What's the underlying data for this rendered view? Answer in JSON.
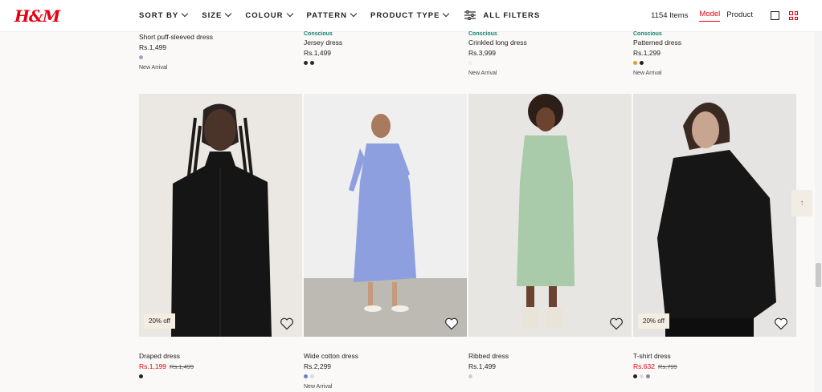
{
  "header": {
    "logo": "H&M",
    "filters": [
      "SORT BY",
      "SIZE",
      "COLOUR",
      "PATTERN",
      "PRODUCT TYPE"
    ],
    "all_filters": "ALL FILTERS",
    "item_count": "1154 Items",
    "view_model": "Model",
    "view_product": "Product"
  },
  "top_row": [
    {
      "tag": "",
      "name": "Short puff-sleeved dress",
      "price": "Rs.1,499",
      "swatches": [
        "#9aa6cf"
      ],
      "marker": "New Arrival"
    },
    {
      "tag": "Conscious",
      "name": "Jersey dress",
      "price": "Rs.1,499",
      "swatches": [
        "#2a2a2a",
        "#2a2a2a"
      ],
      "marker": ""
    },
    {
      "tag": "Conscious",
      "name": "Crinkled long dress",
      "price": "Rs.3,999",
      "swatches": [
        "#eeeeee"
      ],
      "marker": "New Arrival"
    },
    {
      "tag": "Conscious",
      "name": "Patterned dress",
      "price": "Rs.1,299",
      "swatches": [
        "#e89a3a",
        "#222222"
      ],
      "marker": "New Arrival"
    }
  ],
  "bottom_row": [
    {
      "name": "Draped dress",
      "price": "Rs.1,199",
      "old_price": "Rs.1,499",
      "badge": "20% off",
      "swatches": [
        "#222222"
      ],
      "marker": ""
    },
    {
      "name": "Wide cotton dress",
      "price": "Rs.2,299",
      "old_price": "",
      "badge": "",
      "swatches": [
        "#6a7fc8",
        "#dddddd"
      ],
      "marker": "New Arrival"
    },
    {
      "name": "Ribbed dress",
      "price": "Rs.1,499",
      "old_price": "",
      "badge": "",
      "swatches": [
        "#cccccc"
      ],
      "marker": ""
    },
    {
      "name": "T-shirt dress",
      "price": "Rs.632",
      "old_price": "Rs.799",
      "badge": "20% off",
      "swatches": [
        "#222222",
        "#dddddd",
        "#888888"
      ],
      "marker": ""
    }
  ],
  "colors": {
    "brand": "#e50010",
    "conscious": "#17816e",
    "badge_bg": "#f4ede2"
  },
  "icons": {
    "filter": "sliders-icon",
    "favorite": "heart-icon",
    "scroll_top": "arrow-up-icon"
  }
}
